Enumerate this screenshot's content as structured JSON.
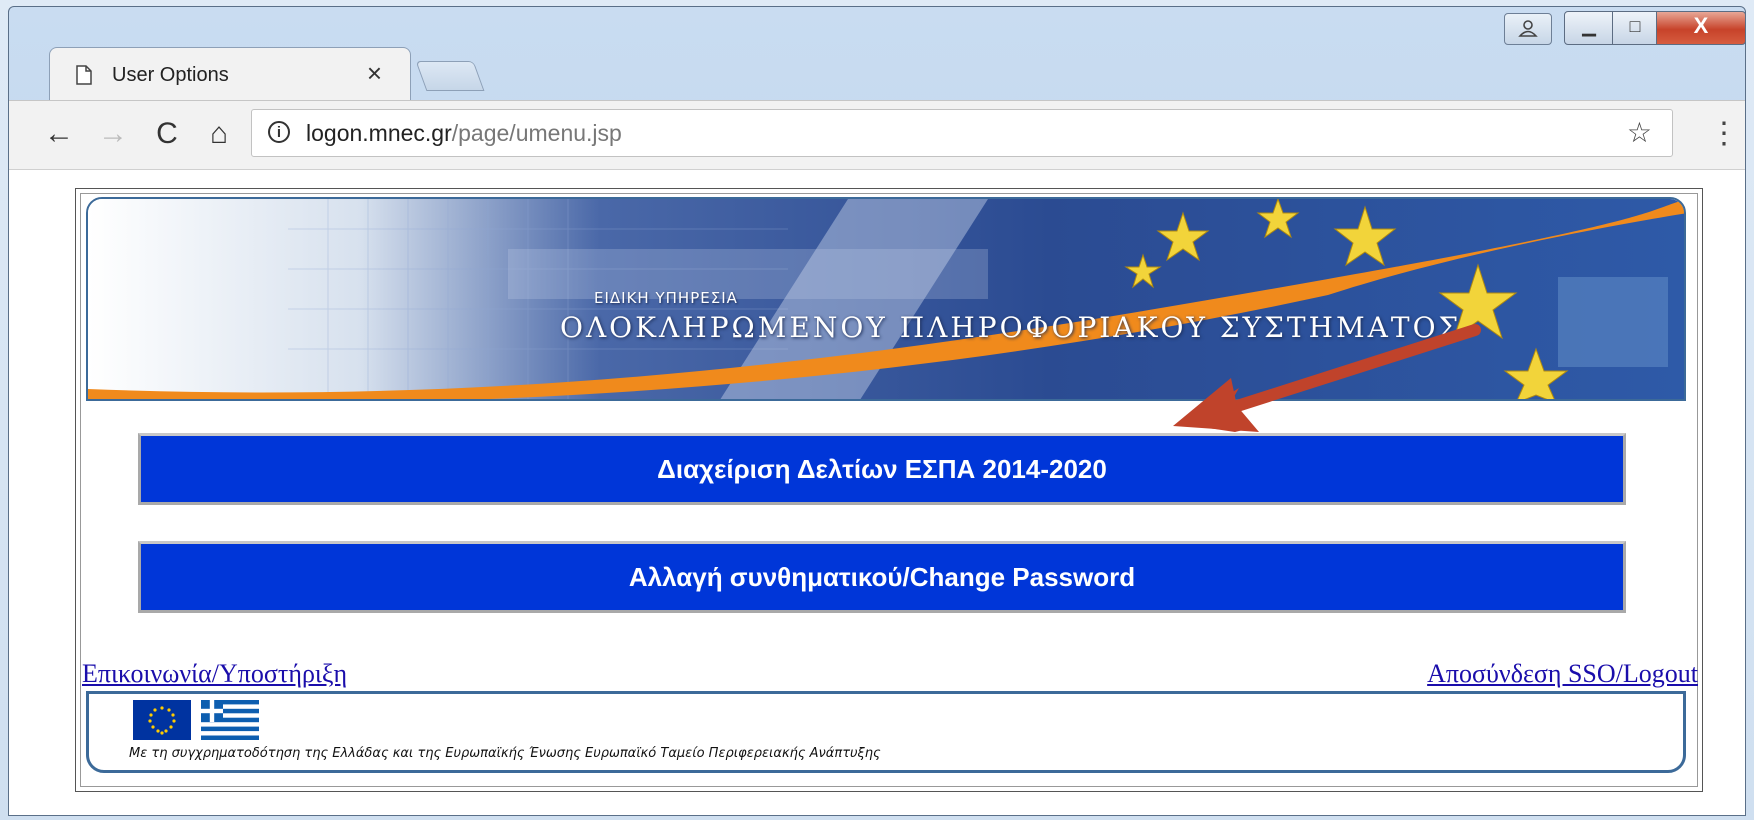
{
  "browser": {
    "tab_title": "User Options",
    "tab_close": "×",
    "url_host": "logon.mnec.gr",
    "url_path": "/page/umenu.jsp",
    "nav_back": "←",
    "nav_forward": "→",
    "nav_reload": "C",
    "nav_home": "⌂",
    "bookmark": "☆",
    "menu": "⋮",
    "window_min": "▁",
    "window_max": "□",
    "window_close": "X"
  },
  "banner": {
    "subtitle": "ΕΙΔΙΚΗ ΥΠΗΡΕΣΙΑ",
    "title": "ΟΛΟΚΛΗΡΩΜΕΝΟΥ ΠΛΗΡΟΦΟΡΙΑΚΟΥ ΣΥΣΤΗΜΑΤΟΣ"
  },
  "menu": {
    "espa_button": "Διαχείριση Δελτίων ΕΣΠΑ 2014-2020",
    "password_button": "Αλλαγή συνθηματικού/Change Password"
  },
  "links": {
    "contact": "Επικοινωνία/Υποστήριξη",
    "logout": "Αποσύνδεση SSO/Logout"
  },
  "footer": {
    "cofunding_text": "Με τη συγχρηματοδότηση της Ελλάδας και της Ευρωπαϊκής Ένωσης Ευρωπαϊκό Ταμείο Περιφερειακής Ανάπτυξης"
  },
  "colors": {
    "button_blue": "#0036d8",
    "annotation_arrow": "#c0432b",
    "banner_orange": "#f08a1c"
  }
}
